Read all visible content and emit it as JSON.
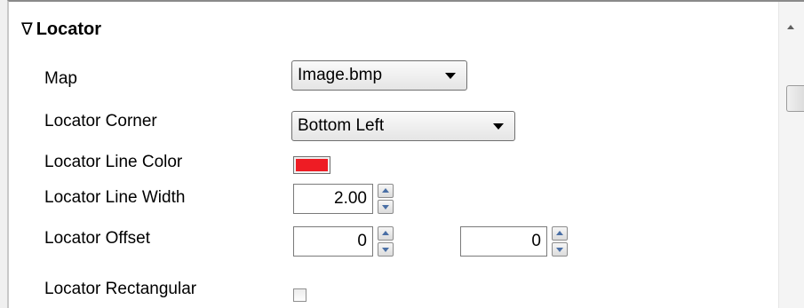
{
  "section": {
    "toggle_glyph": "∇",
    "title": "Locator"
  },
  "rows": {
    "map": {
      "label": "Map",
      "value": "Image.bmp"
    },
    "corner": {
      "label": "Locator Corner",
      "value": "Bottom Left"
    },
    "line_color": {
      "label": "Locator Line Color",
      "color": "#ee1c24"
    },
    "line_width": {
      "label": "Locator Line Width",
      "value": "2.00"
    },
    "offset": {
      "label": "Locator Offset",
      "value_x": "0",
      "value_y": "0"
    },
    "rectangular": {
      "label": "Locator Rectangular",
      "checked": false
    }
  },
  "icons": {
    "dropdown": "chevron-down-icon",
    "spin_up": "spin-up-icon",
    "spin_down": "spin-down-icon",
    "scroll_up": "scroll-up-icon"
  }
}
